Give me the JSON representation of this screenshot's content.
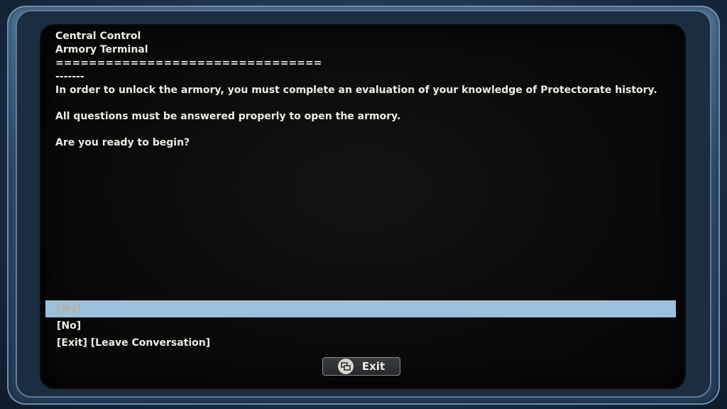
{
  "terminal": {
    "header_line1": "Central Control",
    "header_line2": "Armory Terminal",
    "divider_long": "================================",
    "divider_short": "-------",
    "body_para1": "In order to unlock the armory, you must complete an evaluation of your knowledge of Protectorate history.",
    "body_para2": "All questions must be answered properly to open the armory.",
    "body_para3": "Are you ready to begin?"
  },
  "options": [
    {
      "label": "[Yes]",
      "selected": true
    },
    {
      "label": "[No]",
      "selected": false
    },
    {
      "label": "[Exit] [Leave Conversation]",
      "selected": false
    }
  ],
  "exit_button": {
    "label": "Exit",
    "icon": "controller-back-icon"
  },
  "colors": {
    "screen_bg": "#0a0a0a",
    "text": "#efece4",
    "highlight_bg": "#9cc0dc",
    "highlight_text": "#c8a36a",
    "bezel": "#2f4c68"
  }
}
